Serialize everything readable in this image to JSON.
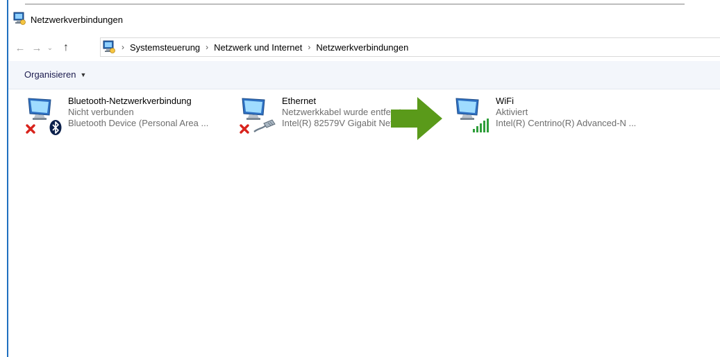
{
  "window": {
    "title": "Netzwerkverbindungen",
    "icon": "network-connections-icon"
  },
  "nav": {
    "breadcrumbs": [
      "Systemsteuerung",
      "Netzwerk und Internet",
      "Netzwerkverbindungen"
    ]
  },
  "toolbar": {
    "organize_label": "Organisieren"
  },
  "connections": [
    {
      "name": "Bluetooth-Netzwerkverbindung",
      "status": "Nicht verbunden",
      "device": "Bluetooth Device (Personal Area ...",
      "badge": "bluetooth-icon",
      "error": true
    },
    {
      "name": "Ethernet",
      "status": "Netzwerkkabel wurde entfernt",
      "device": "Intel(R) 82579V Gigabit Network C...",
      "badge": "ethernet-cable-icon",
      "error": true
    },
    {
      "name": "WiFi",
      "status": "Aktiviert",
      "device": "Intel(R) Centrino(R) Advanced-N ...",
      "badge": "signal-bars-icon",
      "error": false
    }
  ],
  "colors": {
    "accent": "#1f6fbf",
    "toolbar_bg": "#f3f6fb",
    "arrow": "#5a9a1a",
    "error_red": "#d8231c",
    "signal_green": "#2e9e3a"
  }
}
